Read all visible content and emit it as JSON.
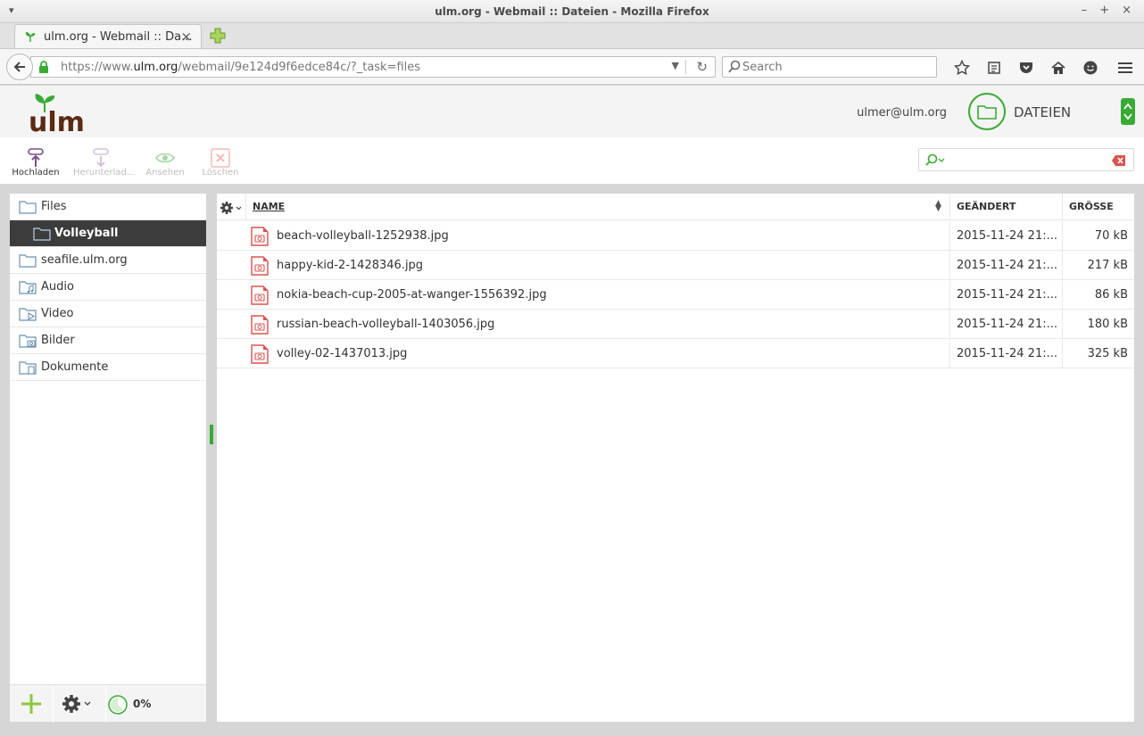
{
  "window": {
    "title": "ulm.org - Webmail :: Dateien - Mozilla Firefox",
    "tab_label": "ulm.org - Webmail :: Da...",
    "url_prefix": "https://www.",
    "url_domain": "ulm.org",
    "url_path": "/webmail/9e124d9f6edce84c/?_task=files",
    "search_placeholder": "Search"
  },
  "header": {
    "user": "ulmer@ulm.org",
    "app_label": "DATEIEN",
    "accent_color": "#3aaa35"
  },
  "toolbar": {
    "upload": "Hochladen",
    "download": "Herunterlad...",
    "view": "Ansehen",
    "delete": "Löschen"
  },
  "sidebar": {
    "folders": [
      {
        "label": "Files",
        "icon": "folder-icon"
      },
      {
        "label": "Volleyball",
        "icon": "folder-icon",
        "selected": true
      },
      {
        "label": "seafile.ulm.org",
        "icon": "folder-icon"
      },
      {
        "label": "Audio",
        "icon": "audio-folder-icon"
      },
      {
        "label": "Video",
        "icon": "video-folder-icon"
      },
      {
        "label": "Bilder",
        "icon": "image-folder-icon"
      },
      {
        "label": "Dokumente",
        "icon": "document-folder-icon"
      }
    ],
    "quota": "0%"
  },
  "filelist": {
    "columns": {
      "name": "NAME",
      "modified": "GEÄNDERT",
      "size": "GRÖSSE"
    },
    "files": [
      {
        "name": "beach-volleyball-1252938.jpg",
        "modified": "2015-11-24 21:...",
        "size": "70 kB"
      },
      {
        "name": "happy-kid-2-1428346.jpg",
        "modified": "2015-11-24 21:...",
        "size": "217 kB"
      },
      {
        "name": "nokia-beach-cup-2005-at-wanger-1556392.jpg",
        "modified": "2015-11-24 21:...",
        "size": "86 kB"
      },
      {
        "name": "russian-beach-volleyball-1403056.jpg",
        "modified": "2015-11-24 21:...",
        "size": "180 kB"
      },
      {
        "name": "volley-02-1437013.jpg",
        "modified": "2015-11-24 21:...",
        "size": "325 kB"
      }
    ]
  }
}
